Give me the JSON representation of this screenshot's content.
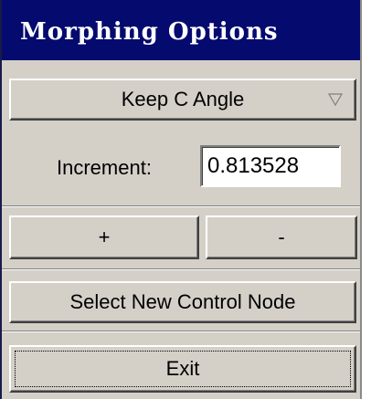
{
  "window": {
    "title": "Morphing Options"
  },
  "mode_dropdown": {
    "selected": "Keep C Angle",
    "icon": "triangle-down-icon"
  },
  "increment": {
    "label": "Increment:",
    "value": "0.813528"
  },
  "buttons": {
    "plus": "+",
    "minus": "-",
    "select_node": "Select New Control Node",
    "exit": "Exit"
  },
  "colors": {
    "titlebar": "#040a6e",
    "face": "#d4d0c8"
  }
}
